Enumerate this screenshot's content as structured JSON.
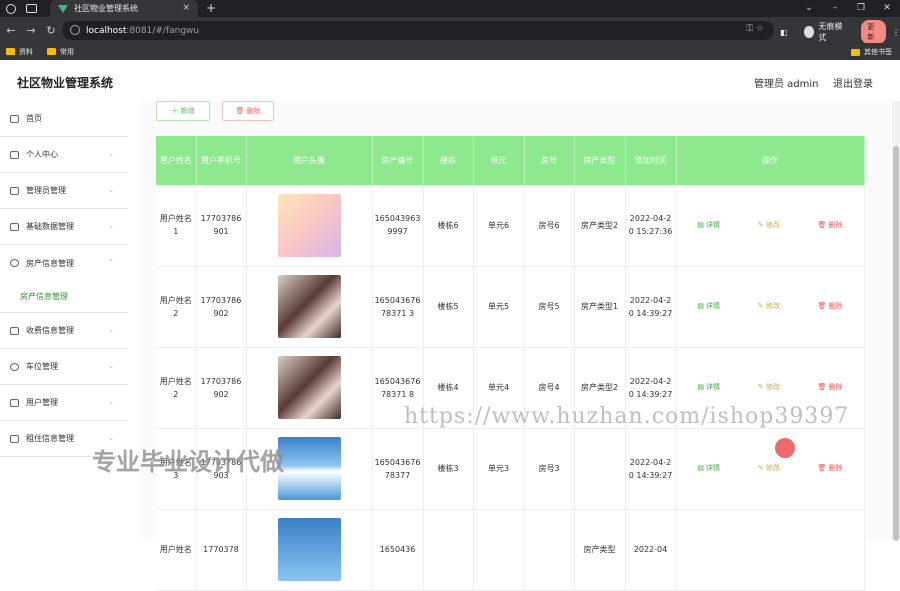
{
  "browser": {
    "tab_title": "社区物业管理系统",
    "url_host": "localhost",
    "url_path": ":8081/#/fangwu",
    "profile_label": "无痕模式",
    "update_label": "更新",
    "bookmarks": [
      "资料",
      "常用"
    ],
    "bookmarks_right": "其他书签"
  },
  "header": {
    "app_title": "社区物业管理系统",
    "user_label": "管理员 admin",
    "logout_label": "退出登录"
  },
  "sidebar": {
    "items": [
      {
        "label": "首页",
        "icon": "home-icon"
      },
      {
        "label": "个人中心",
        "icon": "user-icon"
      },
      {
        "label": "管理员管理",
        "icon": "monitor-icon"
      },
      {
        "label": "基础数据管理",
        "icon": "sliders-icon"
      },
      {
        "label": "房产信息管理",
        "icon": "power-icon",
        "expanded": true
      },
      {
        "label": "收费信息管理",
        "icon": "menu-icon"
      },
      {
        "label": "车位管理",
        "icon": "dashboard-icon"
      },
      {
        "label": "用户管理",
        "icon": "frame-icon"
      },
      {
        "label": "租住信息管理",
        "icon": "pin-icon"
      }
    ],
    "sub_item": "房产信息管理"
  },
  "toolbar": {
    "add_label": "＋ 新增",
    "delete_label": "🗑 删除"
  },
  "table": {
    "headers": [
      "用户姓名",
      "用户手机号",
      "用户头像",
      "房产编号",
      "楼栋",
      "单元",
      "房号",
      "房产类型",
      "添加时间",
      "操作"
    ],
    "rows": [
      {
        "name": "用户姓名1",
        "phone": "17703786901",
        "code": "1650439639997",
        "building": "楼栋6",
        "unit": "单元6",
        "room": "房号6",
        "type": "房产类型2",
        "time": "2022-04-20 15:27:36"
      },
      {
        "name": "用户姓名2",
        "phone": "17703786902",
        "code": "16504367678371 3",
        "building": "楼栋5",
        "unit": "单元5",
        "room": "房号5",
        "type": "房产类型1",
        "time": "2022-04-20 14:39:27"
      },
      {
        "name": "用户姓名2",
        "phone": "17703786902",
        "code": "16504367678371 8",
        "building": "楼栋4",
        "unit": "单元4",
        "room": "房号4",
        "type": "房产类型2",
        "time": "2022-04-20 14:39:27"
      },
      {
        "name": "用户姓名3",
        "phone": "17703786903",
        "code": "16504367678377",
        "building": "楼栋3",
        "unit": "单元3",
        "room": "房号3",
        "type": "",
        "time": "2022-04-20 14:39:27"
      },
      {
        "name": "用户姓名",
        "phone": "1770378",
        "code": "1650436",
        "building": "",
        "unit": "",
        "room": "",
        "type": "房产类型",
        "time": "2022-04"
      }
    ],
    "actions": {
      "detail": "详情",
      "edit": "修改",
      "delete": "删除"
    }
  },
  "watermark": {
    "url_text": "https://www.huzhan.com/ishop39397",
    "cn_text": "专业毕业设计代做"
  },
  "colors": {
    "accent": "#8ee88e",
    "link_green": "#3aa83a",
    "edit_orange": "#e6a23c",
    "delete_red": "#e55"
  }
}
